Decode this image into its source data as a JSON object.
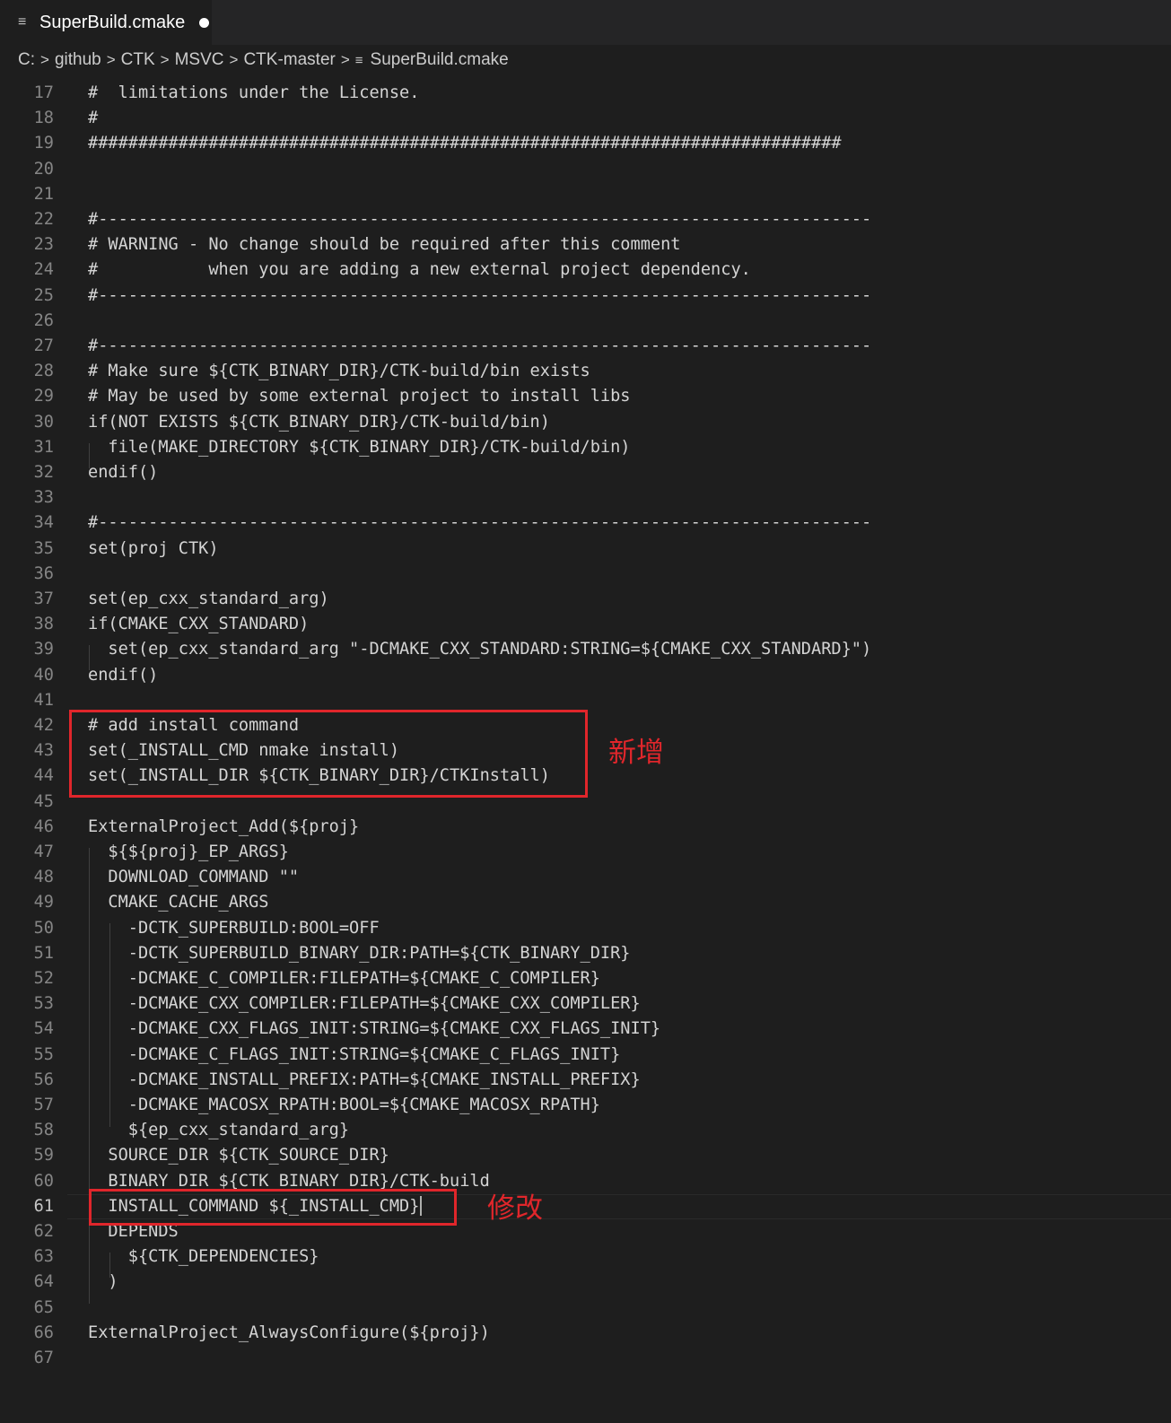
{
  "tab": {
    "title": "SuperBuild.cmake",
    "icon": "file-lines-icon",
    "modified": true
  },
  "breadcrumb": [
    "C:",
    "github",
    "CTK",
    "MSVC",
    "CTK-master",
    "SuperBuild.cmake"
  ],
  "editor": {
    "current_line": 61,
    "lines": [
      {
        "n": "17",
        "text": "#  limitations under the License."
      },
      {
        "n": "18",
        "text": "#"
      },
      {
        "n": "19",
        "text": "###########################################################################"
      },
      {
        "n": "20",
        "text": ""
      },
      {
        "n": "21",
        "text": ""
      },
      {
        "n": "22",
        "text": "#-----------------------------------------------------------------------------"
      },
      {
        "n": "23",
        "text": "# WARNING - No change should be required after this comment"
      },
      {
        "n": "24",
        "text": "#           when you are adding a new external project dependency."
      },
      {
        "n": "25",
        "text": "#-----------------------------------------------------------------------------"
      },
      {
        "n": "26",
        "text": ""
      },
      {
        "n": "27",
        "text": "#-----------------------------------------------------------------------------"
      },
      {
        "n": "28",
        "text": "# Make sure ${CTK_BINARY_DIR}/CTK-build/bin exists"
      },
      {
        "n": "29",
        "text": "# May be used by some external project to install libs"
      },
      {
        "n": "30",
        "text": "if(NOT EXISTS ${CTK_BINARY_DIR}/CTK-build/bin)"
      },
      {
        "n": "31",
        "text": "  file(MAKE_DIRECTORY ${CTK_BINARY_DIR}/CTK-build/bin)"
      },
      {
        "n": "32",
        "text": "endif()"
      },
      {
        "n": "33",
        "text": ""
      },
      {
        "n": "34",
        "text": "#-----------------------------------------------------------------------------"
      },
      {
        "n": "35",
        "text": "set(proj CTK)"
      },
      {
        "n": "36",
        "text": ""
      },
      {
        "n": "37",
        "text": "set(ep_cxx_standard_arg)"
      },
      {
        "n": "38",
        "text": "if(CMAKE_CXX_STANDARD)"
      },
      {
        "n": "39",
        "text": "  set(ep_cxx_standard_arg \"-DCMAKE_CXX_STANDARD:STRING=${CMAKE_CXX_STANDARD}\")"
      },
      {
        "n": "40",
        "text": "endif()"
      },
      {
        "n": "41",
        "text": ""
      },
      {
        "n": "42",
        "text": "# add install command"
      },
      {
        "n": "43",
        "text": "set(_INSTALL_CMD nmake install)"
      },
      {
        "n": "44",
        "text": "set(_INSTALL_DIR ${CTK_BINARY_DIR}/CTKInstall)"
      },
      {
        "n": "45",
        "text": ""
      },
      {
        "n": "46",
        "text": "ExternalProject_Add(${proj}"
      },
      {
        "n": "47",
        "text": "  ${${proj}_EP_ARGS}"
      },
      {
        "n": "48",
        "text": "  DOWNLOAD_COMMAND \"\""
      },
      {
        "n": "49",
        "text": "  CMAKE_CACHE_ARGS"
      },
      {
        "n": "50",
        "text": "    -DCTK_SUPERBUILD:BOOL=OFF"
      },
      {
        "n": "51",
        "text": "    -DCTK_SUPERBUILD_BINARY_DIR:PATH=${CTK_BINARY_DIR}"
      },
      {
        "n": "52",
        "text": "    -DCMAKE_C_COMPILER:FILEPATH=${CMAKE_C_COMPILER}"
      },
      {
        "n": "53",
        "text": "    -DCMAKE_CXX_COMPILER:FILEPATH=${CMAKE_CXX_COMPILER}"
      },
      {
        "n": "54",
        "text": "    -DCMAKE_CXX_FLAGS_INIT:STRING=${CMAKE_CXX_FLAGS_INIT}"
      },
      {
        "n": "55",
        "text": "    -DCMAKE_C_FLAGS_INIT:STRING=${CMAKE_C_FLAGS_INIT}"
      },
      {
        "n": "56",
        "text": "    -DCMAKE_INSTALL_PREFIX:PATH=${CMAKE_INSTALL_PREFIX}"
      },
      {
        "n": "57",
        "text": "    -DCMAKE_MACOSX_RPATH:BOOL=${CMAKE_MACOSX_RPATH}"
      },
      {
        "n": "58",
        "text": "    ${ep_cxx_standard_arg}"
      },
      {
        "n": "59",
        "text": "  SOURCE_DIR ${CTK_SOURCE_DIR}"
      },
      {
        "n": "60",
        "text": "  BINARY_DIR ${CTK_BINARY_DIR}/CTK-build"
      },
      {
        "n": "61",
        "text": "  INSTALL_COMMAND ${_INSTALL_CMD}"
      },
      {
        "n": "62",
        "text": "  DEPENDS"
      },
      {
        "n": "63",
        "text": "    ${CTK_DEPENDENCIES}"
      },
      {
        "n": "64",
        "text": "  )"
      },
      {
        "n": "65",
        "text": ""
      },
      {
        "n": "66",
        "text": "ExternalProject_AlwaysConfigure(${proj})"
      },
      {
        "n": "67",
        "text": ""
      }
    ]
  },
  "annotations": {
    "added": "新增",
    "modified": "修改"
  },
  "colors": {
    "background": "#1e1e1e",
    "text": "#d4d4d4",
    "line_number": "#858585",
    "annotation": "#e0262b"
  }
}
